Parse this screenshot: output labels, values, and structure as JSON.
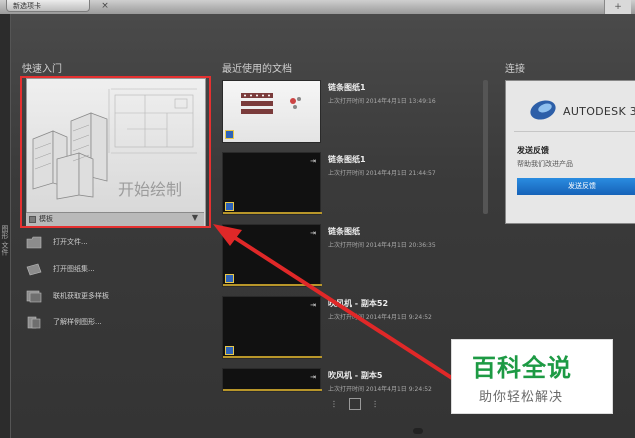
{
  "top_tab": {
    "title": "新选项卡",
    "close": "×",
    "plus": "+"
  },
  "sidebar": {
    "vertical_label": "图形 文件"
  },
  "sections": {
    "quick_start": "快速入门",
    "recent_docs": "最近使用的文档",
    "connect": "连接"
  },
  "start_drawing": {
    "label": "开始绘制",
    "template_label": "模板"
  },
  "quick_items": [
    {
      "label": "打开文件...",
      "icon": "folder-icon"
    },
    {
      "label": "打开图纸集...",
      "icon": "sheet-set-icon"
    },
    {
      "label": "联机获取更多样板",
      "icon": "online-template-icon"
    },
    {
      "label": "了解样例图形...",
      "icon": "sample-drawing-icon"
    }
  ],
  "recent_documents": [
    {
      "title": "链条图纸1",
      "meta": "上次打开时间 2014年4月1日 13:49:16",
      "thumb": "light"
    },
    {
      "title": "链条图纸1",
      "meta": "上次打开时间 2014年4月1日 21:44:57",
      "thumb": "dark"
    },
    {
      "title": "链条图纸",
      "meta": "上次打开时间 2014年4月1日 20:36:35",
      "thumb": "dark"
    },
    {
      "title": "吹风机 - 副本52",
      "meta": "上次打开时间 2014年4月1日 9:24:52",
      "thumb": "dark"
    },
    {
      "title": "吹风机 - 副本5",
      "meta": "上次打开时间 2014年4月1日 9:24:52",
      "thumb": "dark"
    }
  ],
  "connect_panel": {
    "brand": "AUTODESK 3",
    "heading": "发送反馈",
    "subtext": "帮助我们改进产品",
    "button": "发送反馈"
  },
  "watermark": {
    "title": "百科全说",
    "subtitle": "助你轻松解决"
  },
  "colors": {
    "highlight": "#e53030",
    "autodesk_blue": "#1662b8",
    "watermark_green": "#1d9a44"
  }
}
